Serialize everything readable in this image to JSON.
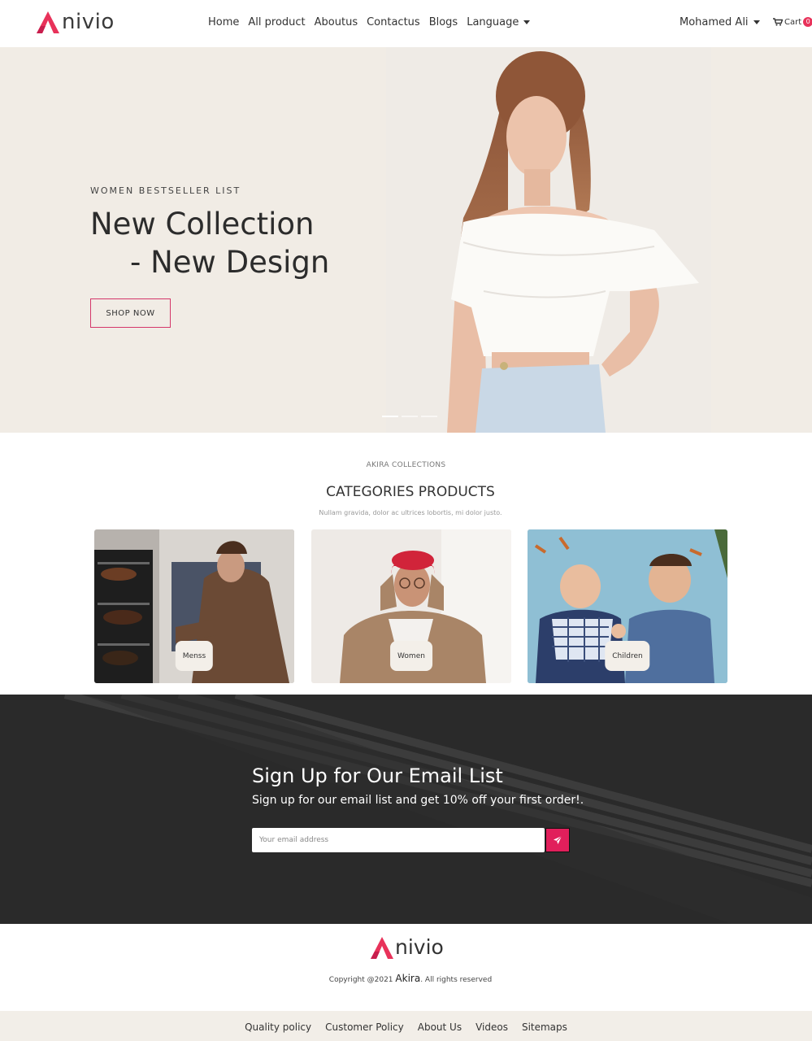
{
  "brand": {
    "name": "nivio",
    "accent": "#e8325a"
  },
  "nav": {
    "links": [
      "Home",
      "All product",
      "Aboutus",
      "Contactus",
      "Blogs"
    ],
    "language_label": "Language",
    "user_name": "Mohamed Ali",
    "cart_label": "Cart",
    "cart_count": "0"
  },
  "hero": {
    "kicker": "WOMEN BESTSELLER LIST",
    "title_line1": "New Collection",
    "title_line2": "- New Design",
    "button_label": "SHOP NOW",
    "slide_count": 3,
    "active_slide": 1
  },
  "categories": {
    "kicker": "AKIRA COLLECTIONS",
    "title": "CATEGORIES PRODUCTS",
    "subtitle": "Nullam gravida, dolor ac ultrices lobortis, mi dolor justo.",
    "items": [
      {
        "label": "Menss"
      },
      {
        "label": "Women"
      },
      {
        "label": "Children"
      }
    ]
  },
  "newsletter": {
    "title": "Sign Up for Our Email List",
    "subtitle": "Sign up for our email list and get 10% off your first order!.",
    "email_placeholder": "Your email address",
    "send_icon": "paper-plane-icon"
  },
  "footer": {
    "copyright_prefix": "Copyright @2021",
    "copyright_brand": "Akira",
    "copyright_suffix": ". All rights reserved",
    "links": [
      "Quality policy",
      "Customer Policy",
      "About Us",
      "Videos",
      "Sitemaps"
    ]
  }
}
